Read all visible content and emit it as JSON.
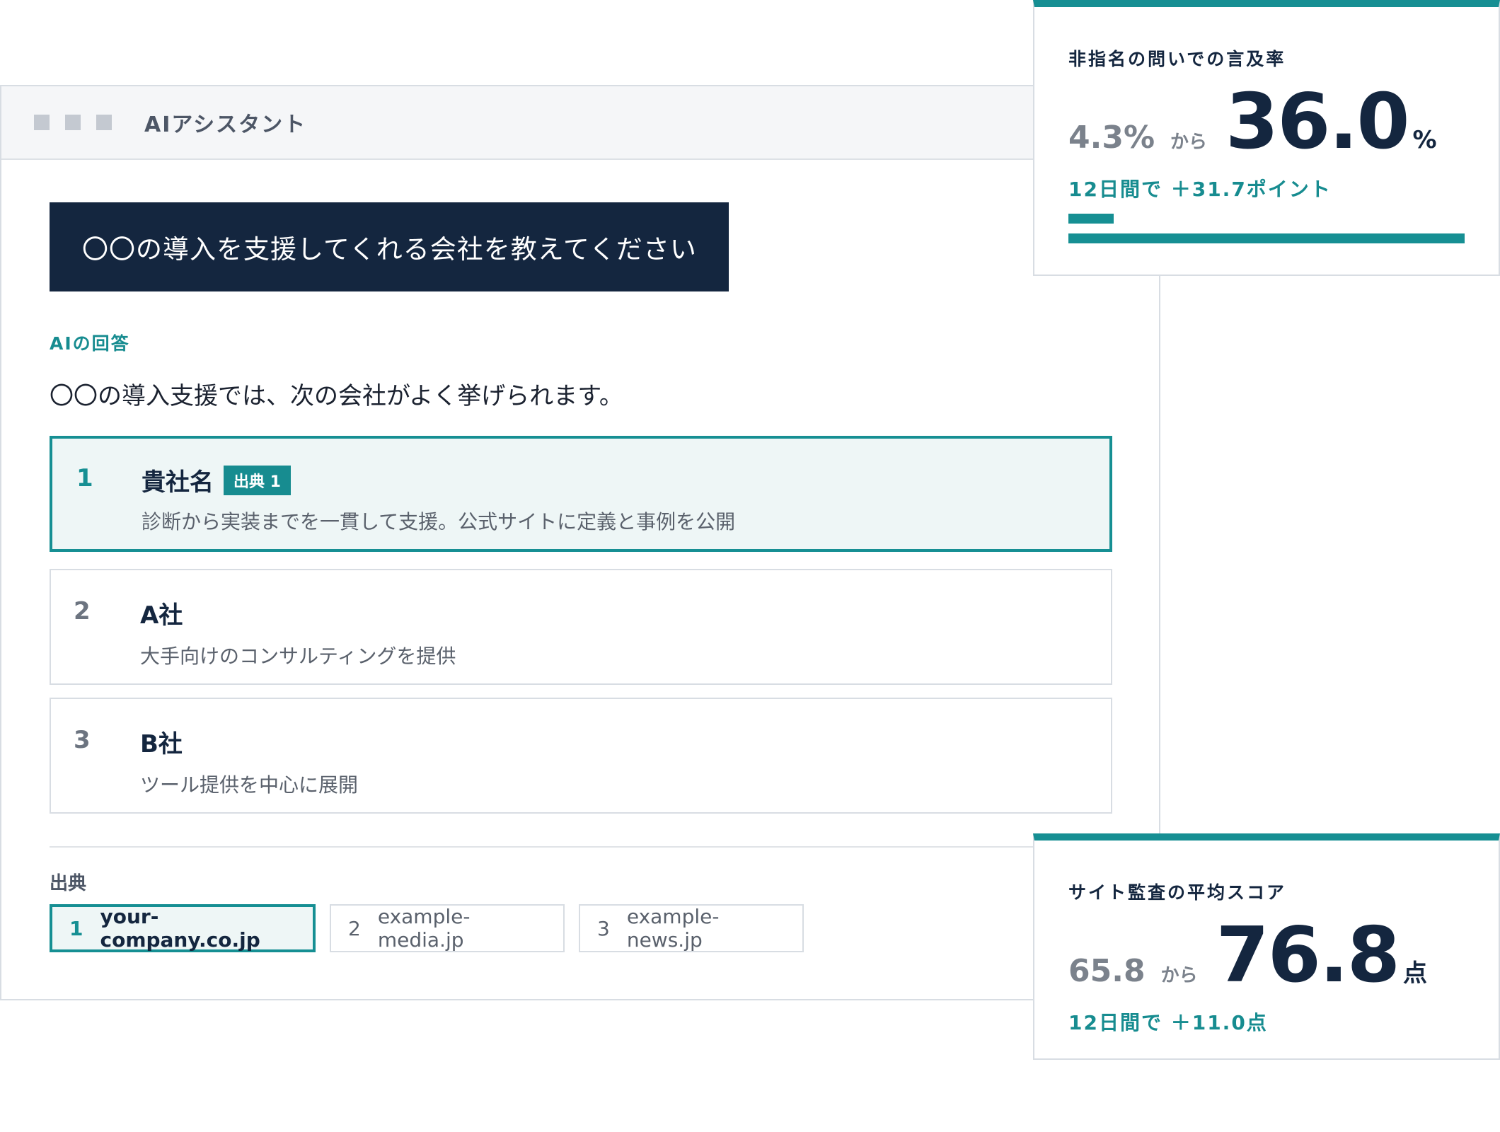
{
  "window": {
    "title": "AIアシスタント"
  },
  "question": "〇〇の導入を支援してくれる会社を教えてください",
  "answer": {
    "label": "AIの回答",
    "text": "〇〇の導入支援では、次の会社がよく挙げられます。"
  },
  "results": [
    {
      "rank": "1",
      "name": "貴社名",
      "badge": "出典 1",
      "description": "診断から実装までを一貫して支援。公式サイトに定義と事例を公開"
    },
    {
      "rank": "2",
      "name": "A社",
      "description": "大手向けのコンサルティングを提供"
    },
    {
      "rank": "3",
      "name": "B社",
      "description": "ツール提供を中心に展開"
    }
  ],
  "sources": {
    "label": "出典",
    "items": [
      {
        "num": "1",
        "domain": "your-company.co.jp"
      },
      {
        "num": "2",
        "domain": "example-media.jp"
      },
      {
        "num": "3",
        "domain": "example-news.jp"
      }
    ]
  },
  "metrics": [
    {
      "title": "非指名の問いでの言及率",
      "from": "4.3%",
      "kara": "から",
      "to": "36.0",
      "unit": "%",
      "delta": "12日間で ＋31.7ポイント",
      "from_value_percent": 4.3,
      "to_value_percent": 36.0
    },
    {
      "title": "サイト監査の平均スコア",
      "from": "65.8",
      "kara": "から",
      "to": "76.8",
      "unit": "点",
      "delta": "12日間で ＋11.0点"
    }
  ],
  "colors": {
    "accent": "#168f93",
    "navy": "#14263f",
    "border": "#d8dde3"
  }
}
